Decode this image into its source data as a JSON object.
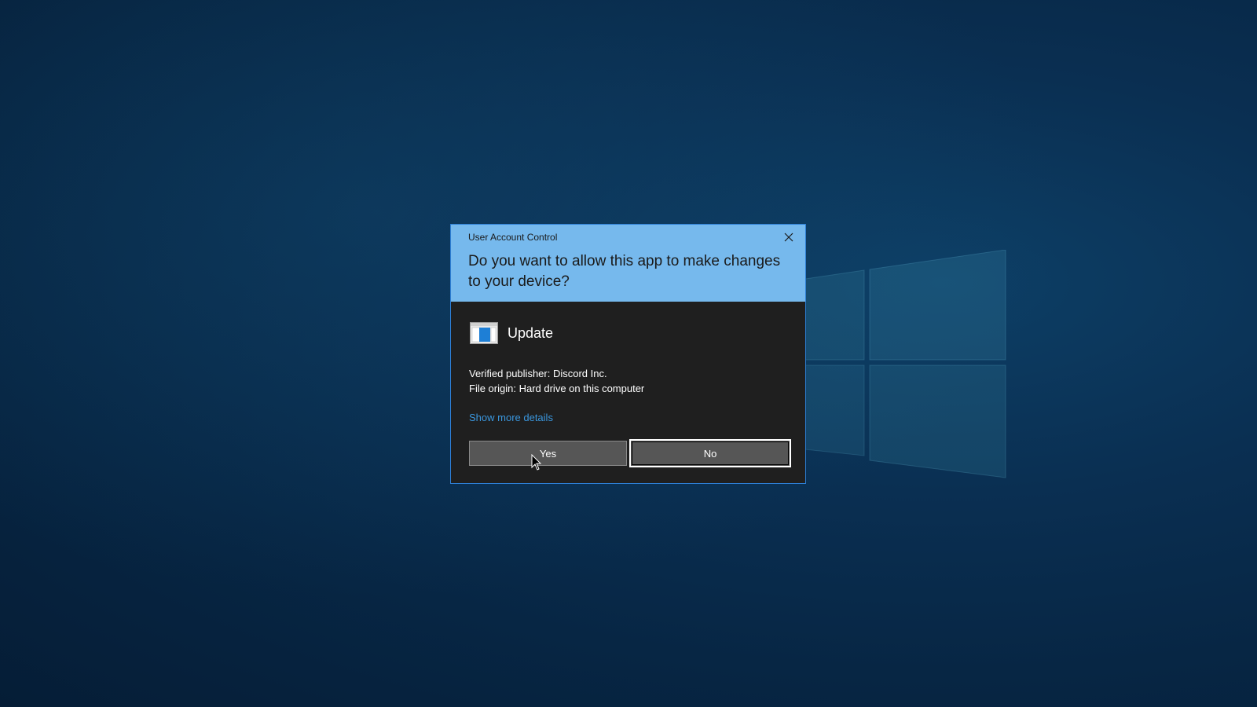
{
  "desktop": {
    "logo_icon": "windows-logo-icon"
  },
  "dialog": {
    "title": "User Account Control",
    "close_icon": "close-icon",
    "question": "Do you want to allow this app to make changes to your device?",
    "app_icon": "application-window-icon",
    "app_name": "Update",
    "publisher_line": "Verified publisher: Discord Inc.",
    "origin_line": "File origin: Hard drive on this computer",
    "details_link": "Show more details",
    "yes_label": "Yes",
    "no_label": "No"
  },
  "colors": {
    "header_bg": "#76b9ed",
    "body_bg": "#1f1f1f",
    "link": "#3a96dd",
    "border_accent": "#2d7fd6",
    "button_bg": "#565656"
  },
  "cursor_icon": "arrow-cursor-icon"
}
